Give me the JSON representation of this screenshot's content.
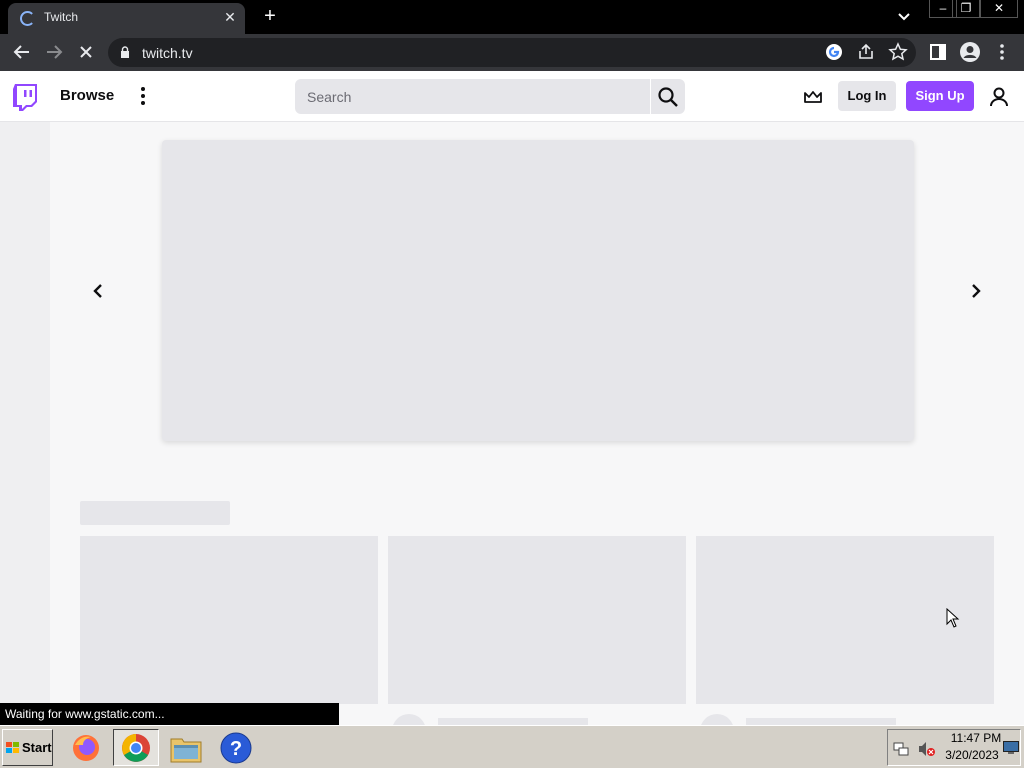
{
  "browser": {
    "tab_title": "Twitch",
    "url": "twitch.tv",
    "status_text": "Waiting for www.gstatic.com..."
  },
  "header": {
    "browse_label": "Browse",
    "search_placeholder": "Search",
    "login_label": "Log In",
    "signup_label": "Sign Up"
  },
  "taskbar": {
    "start_label": "Start",
    "time": "11:47 PM",
    "date": "3/20/2023",
    "apps": [
      "firefox-icon",
      "chrome-icon",
      "file-explorer-icon",
      "help-icon"
    ]
  },
  "colors": {
    "brand": "#9147ff",
    "skeleton": "#e6e6ea",
    "page_bg": "#f7f7f8"
  }
}
